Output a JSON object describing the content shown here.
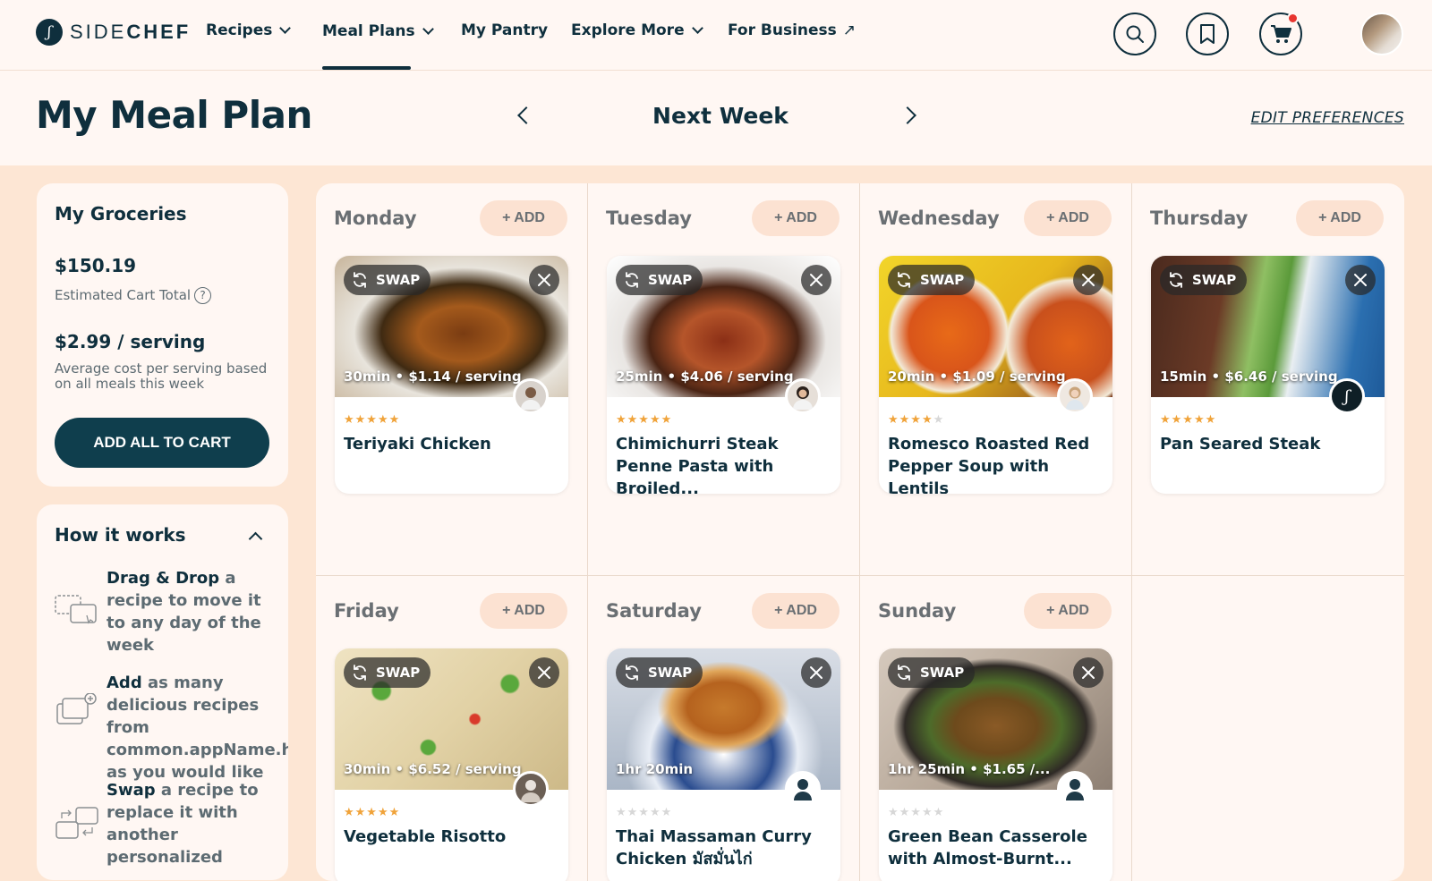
{
  "brand": {
    "logo_glyph": "ʃ",
    "name_left": "SIDE",
    "name_right": "CHEF"
  },
  "nav": {
    "recipes": "Recipes",
    "meal_plans": "Meal Plans",
    "my_pantry": "My Pantry",
    "explore_more": "Explore More",
    "for_business": "For Business",
    "icons": [
      "search-icon",
      "bookmark-icon",
      "cart-icon"
    ]
  },
  "header": {
    "title": "My Meal Plan",
    "week": "Next Week",
    "edit_preferences": "EDIT PREFERENCES"
  },
  "groceries": {
    "title": "My Groceries",
    "total": "$150.19",
    "total_label": "Estimated Cart Total",
    "help": "?",
    "per_serving": "$2.99 / serving",
    "per_serving_label": "Average cost per serving based on all meals this week",
    "add_all": "ADD ALL TO CART"
  },
  "how": {
    "title": "How it works",
    "steps": [
      {
        "bold": "Drag & Drop",
        "rest": " a recipe to move it to any day of the week"
      },
      {
        "bold": "Add",
        "rest": " as many delicious recipes from common.appName.hs as you would like"
      },
      {
        "bold": "Swap",
        "rest": " a recipe to replace it with another personalized"
      }
    ]
  },
  "swap_label": "SWAP",
  "add_label": "+ ADD",
  "days": [
    {
      "name": "Monday",
      "recipe": {
        "title": "Teriyaki Chicken",
        "meta": "30min • $1.14 / serving",
        "rating": 4.5
      }
    },
    {
      "name": "Tuesday",
      "recipe": {
        "title": "Chimichurri Steak Penne Pasta with Broiled...",
        "meta": "25min • $4.06 / serving",
        "rating": 5
      }
    },
    {
      "name": "Wednesday",
      "recipe": {
        "title": "Romesco Roasted Red Pepper Soup with Lentils",
        "meta": "20min • $1.09 / serving",
        "rating": 4
      }
    },
    {
      "name": "Thursday",
      "recipe": {
        "title": "Pan Seared Steak",
        "meta": "15min • $6.46 / serving",
        "rating": 5
      }
    },
    {
      "name": "Friday",
      "recipe": {
        "title": "Vegetable Risotto",
        "meta": "30min • $6.52 / serving",
        "rating": 4.5
      }
    },
    {
      "name": "Saturday",
      "recipe": {
        "title": "Thai Massaman Curry Chicken มัสมั่นไก่",
        "meta": "1hr 20min",
        "rating": 0
      }
    },
    {
      "name": "Sunday",
      "recipe": {
        "title": "Green Bean Casserole with Almost-Burnt...",
        "meta": "1hr 25min • $1.65 /...",
        "rating": 0
      }
    }
  ],
  "stars_glyph": "★★★★★",
  "colors": {
    "navy": "#0f2f3d",
    "peach": "#fde6d4",
    "star": "#f0a33a",
    "cart_dot": "#e8352f"
  }
}
